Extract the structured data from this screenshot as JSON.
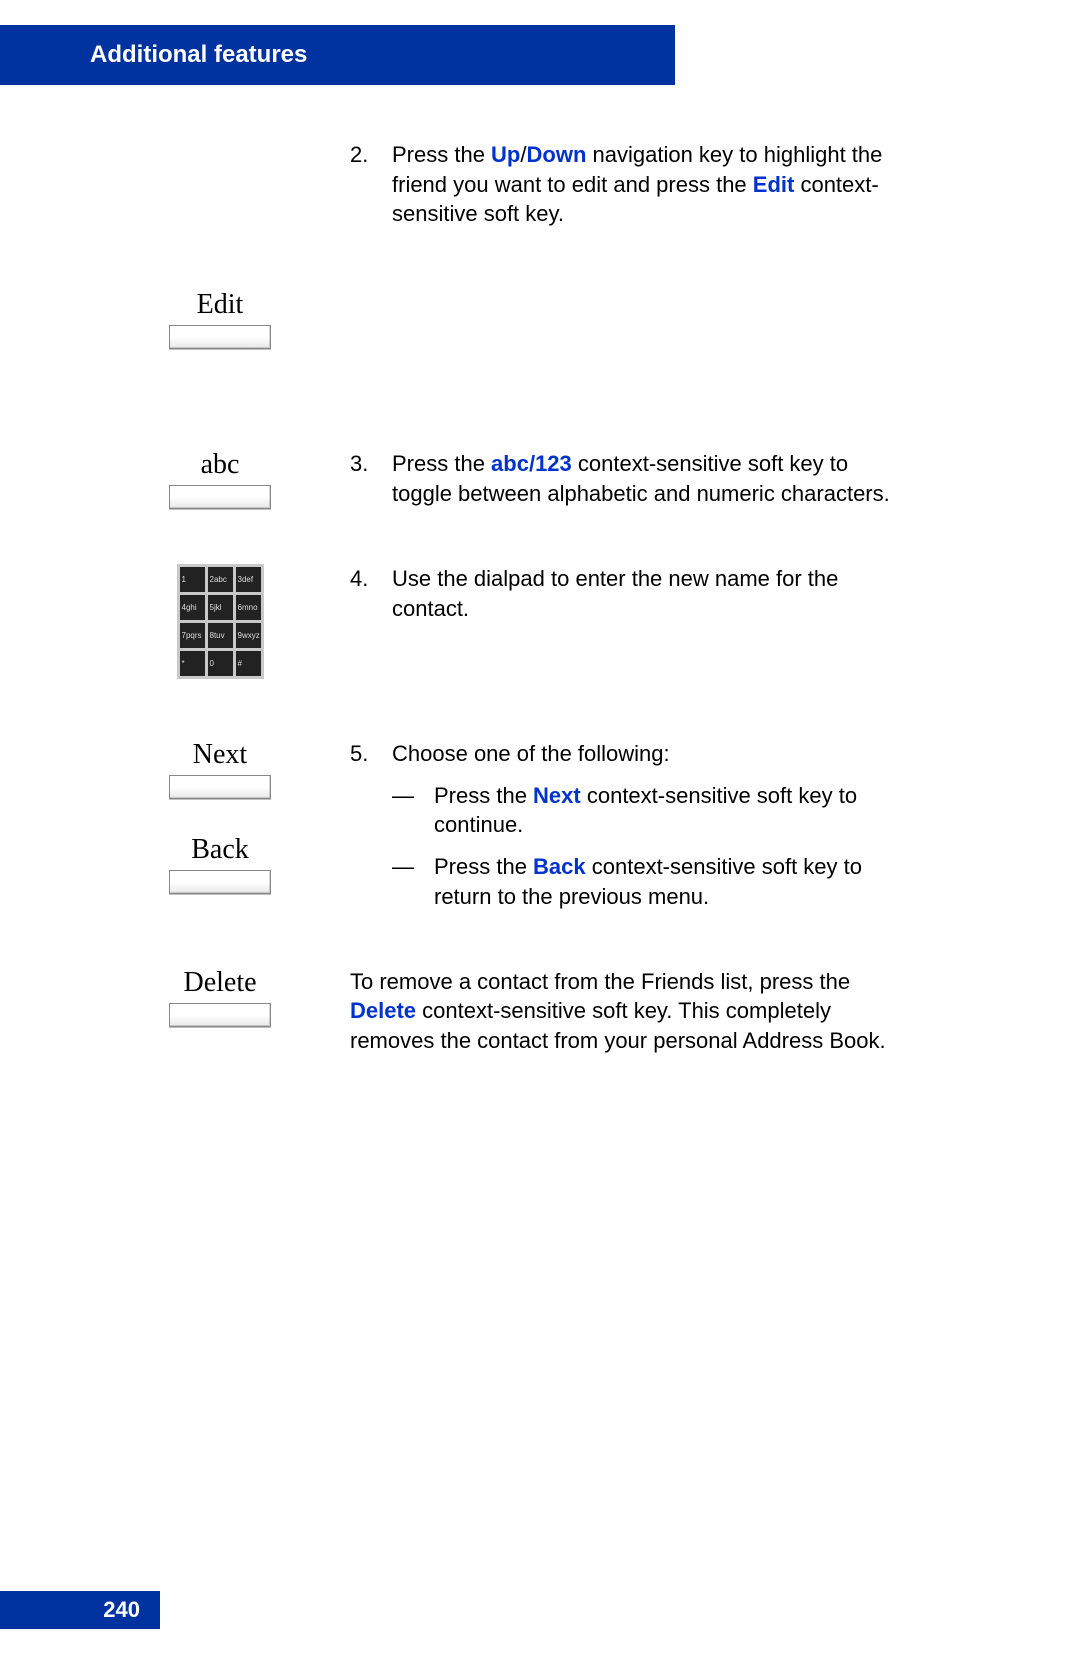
{
  "header": {
    "title": "Additional features"
  },
  "footer": {
    "page_number": "240"
  },
  "softkeys": {
    "edit": {
      "label": "Edit"
    },
    "abc": {
      "label": "abc"
    },
    "next": {
      "label": "Next"
    },
    "back": {
      "label": "Back"
    },
    "delete": {
      "label": "Delete"
    }
  },
  "dialpad": {
    "keys": [
      "1",
      "2abc",
      "3def",
      "4ghi",
      "5jkl",
      "6mno",
      "7pqrs",
      "8tuv",
      "9wxyz",
      "*",
      "0",
      "#"
    ]
  },
  "steps": {
    "s2": {
      "num": "2.",
      "text_a": "Press the ",
      "kw1": "Up",
      "slash": "/",
      "kw2": "Down",
      "text_b": " navigation key to highlight the friend you want to edit and press the ",
      "kw3": "Edit",
      "text_c": " context-sensitive soft key."
    },
    "s3": {
      "num": "3.",
      "text_a": "Press the ",
      "kw1": "abc/123",
      "text_b": " context-sensitive soft key to toggle between alphabetic and numeric characters."
    },
    "s4": {
      "num": "4.",
      "text_a": "Use the dialpad to enter the new name for the contact."
    },
    "s5": {
      "num": "5.",
      "text_a": "Choose one of the following:",
      "opt_next": {
        "dash": "—",
        "a": "Press the ",
        "kw": "Next",
        "b": " context-sensitive soft key to continue."
      },
      "opt_back": {
        "dash": "—",
        "a": "Press the ",
        "kw": "Back",
        "b": " context-sensitive soft key to return to the previous menu."
      }
    },
    "delete_note": {
      "a": "To remove a contact from the Friends list, press the ",
      "kw": "Delete",
      "b": " context-sensitive soft key. This completely removes the contact from your personal Address Book."
    }
  }
}
